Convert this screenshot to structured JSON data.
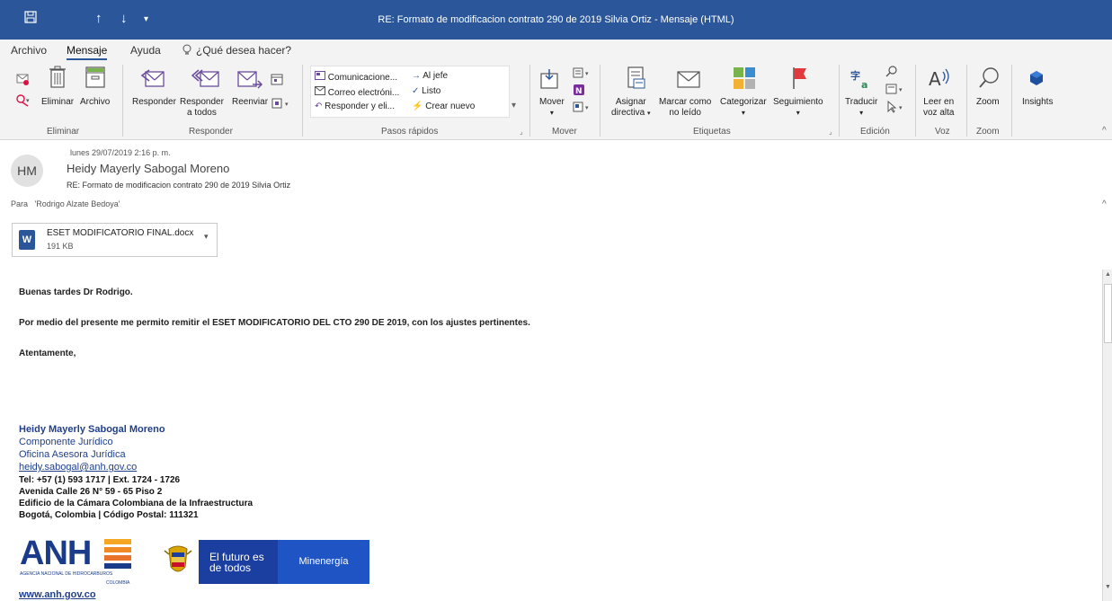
{
  "window": {
    "title": "RE: Formato de modificacion contrato 290 de 2019 Silvia Ortiz  -  Mensaje (HTML)"
  },
  "menu": {
    "tabs": [
      "Archivo",
      "Mensaje",
      "Ayuda"
    ],
    "search": "¿Qué desea hacer?"
  },
  "ribbon": {
    "eliminar": {
      "delete": "Eliminar",
      "archive": "Archivo",
      "group": "Eliminar"
    },
    "responder": {
      "reply": "Responder",
      "reply_all_1": "Responder",
      "reply_all_2": "a todos",
      "forward": "Reenviar",
      "group": "Responder"
    },
    "pasos": {
      "items": [
        "Comunicacione...",
        "Correo electróni...",
        "Responder y eli...",
        "Al jefe",
        "Listo",
        "Crear nuevo"
      ],
      "group": "Pasos rápidos"
    },
    "mover": {
      "move": "Mover",
      "group": "Mover"
    },
    "etiquetas": {
      "assign_1": "Asignar",
      "assign_2": "directiva",
      "unread_1": "Marcar como",
      "unread_2": "no leído",
      "categorize": "Categorizar",
      "followup": "Seguimiento",
      "group": "Etiquetas"
    },
    "edicion": {
      "translate": "Traducir",
      "group": "Edición"
    },
    "voz": {
      "read_1": "Leer en",
      "read_2": "voz alta",
      "group": "Voz"
    },
    "zoom": {
      "zoom": "Zoom",
      "group": "Zoom"
    },
    "insights": {
      "label": "Insights"
    }
  },
  "message": {
    "date": "lunes 29/07/2019 2:16 p. m.",
    "avatar_initials": "HM",
    "from": "Heidy Mayerly Sabogal Moreno",
    "subject": "RE: Formato de modificacion contrato 290 de 2019 Silvia Ortiz",
    "to_label": "Para",
    "to": "'Rodrigo Alzate Bedoya'",
    "attachment": {
      "name": "ESET MODIFICATORIO FINAL.docx",
      "size": "191 KB"
    },
    "body": {
      "greeting": "Buenas tardes Dr Rodrigo.",
      "paragraph": "Por medio del presente me permito remitir el ESET MODIFICATORIO DEL CTO 290 DE 2019, con los ajustes pertinentes.",
      "closing": "Atentamente,"
    },
    "signature": {
      "name": "Heidy Mayerly Sabogal Moreno",
      "role": "Componente Jurídico",
      "office": "Oficina Asesora Jurídica",
      "email": "heidy.sabogal@anh.gov.co",
      "phone": "Tel: +57 (1) 593 1717 | Ext. 1724 - 1726",
      "address": "Avenida Calle 26 N° 59 - 65 Piso 2",
      "building": "Edificio de la Cámara Colombiana de la Infraestructura",
      "city": "Bogotá, Colombia | Código Postal: 111321",
      "website": "www.anh.gov.co"
    },
    "logos": {
      "anh": "ANH",
      "anh_sub": "AGENCIA NACIONAL DE HIDROCARBUROS",
      "anh_country": "COLOMBIA",
      "futuro": "El futuro es de todos",
      "ministry": "Minenergía"
    }
  }
}
